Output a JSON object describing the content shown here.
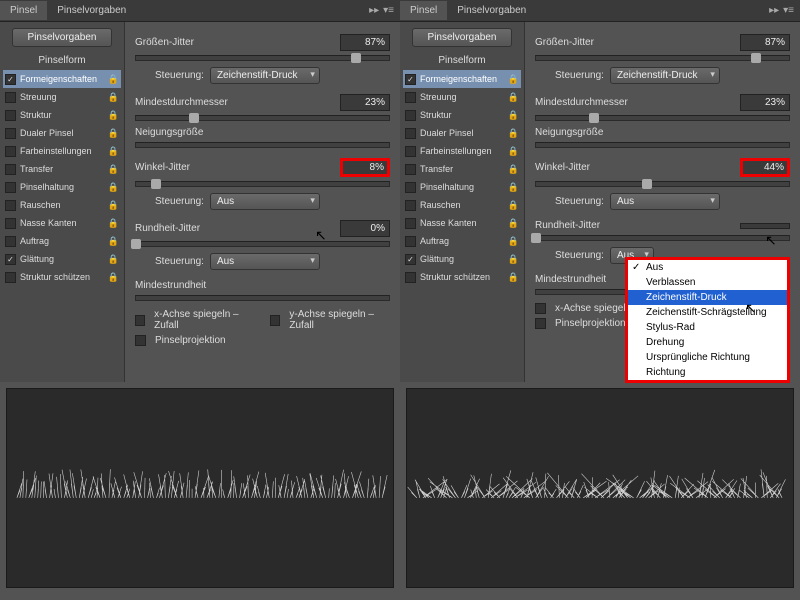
{
  "tabs": {
    "brush": "Pinsel",
    "presets": "Pinselvorgaben"
  },
  "presetsButton": "Pinselvorgaben",
  "brushShapeLabel": "Pinselform",
  "sidebarItems": [
    {
      "label": "Formeigenschaften",
      "checked": true,
      "selected": true,
      "lock": true
    },
    {
      "label": "Streuung",
      "checked": false,
      "lock": true
    },
    {
      "label": "Struktur",
      "checked": false,
      "lock": true
    },
    {
      "label": "Dualer Pinsel",
      "checked": false,
      "lock": true
    },
    {
      "label": "Farbeinstellungen",
      "checked": false,
      "lock": true
    },
    {
      "label": "Transfer",
      "checked": false,
      "lock": true
    },
    {
      "label": "Pinselhaltung",
      "checked": false,
      "lock": true
    },
    {
      "label": "Rauschen",
      "checked": false,
      "lock": true
    },
    {
      "label": "Nasse Kanten",
      "checked": false,
      "lock": true
    },
    {
      "label": "Auftrag",
      "checked": false,
      "lock": true
    },
    {
      "label": "Glättung",
      "checked": true,
      "lock": true
    },
    {
      "label": "Struktur schützen",
      "checked": false,
      "lock": true
    }
  ],
  "labels": {
    "sizeJitter": "Größen-Jitter",
    "control": "Steuerung:",
    "minDiameter": "Mindestdurchmesser",
    "tiltScale": "Neigungsgröße",
    "angleJitter": "Winkel-Jitter",
    "roundnessJitter": "Rundheit-Jitter",
    "minRoundness": "Mindestrundheit",
    "flipX": "x-Achse spiegeln – Zufall",
    "flipY": "y-Achse spiegeln – Zufall",
    "projection": "Pinselprojektion"
  },
  "dropdownValues": {
    "penPressure": "Zeichenstift-Druck",
    "off": "Aus"
  },
  "menuItems": [
    "Aus",
    "Verblassen",
    "Zeichenstift-Druck",
    "Zeichenstift-Schrägstellung",
    "Stylus-Rad",
    "Drehung",
    "Ursprüngliche Richtung",
    "Richtung"
  ],
  "left": {
    "sizeJitter": "87%",
    "minDiameter": "23%",
    "angleJitter": "8%",
    "roundnessJitter": "0%"
  },
  "right": {
    "sizeJitter": "87%",
    "minDiameter": "23%",
    "angleJitter": "44%",
    "roundnessJitter": ""
  }
}
